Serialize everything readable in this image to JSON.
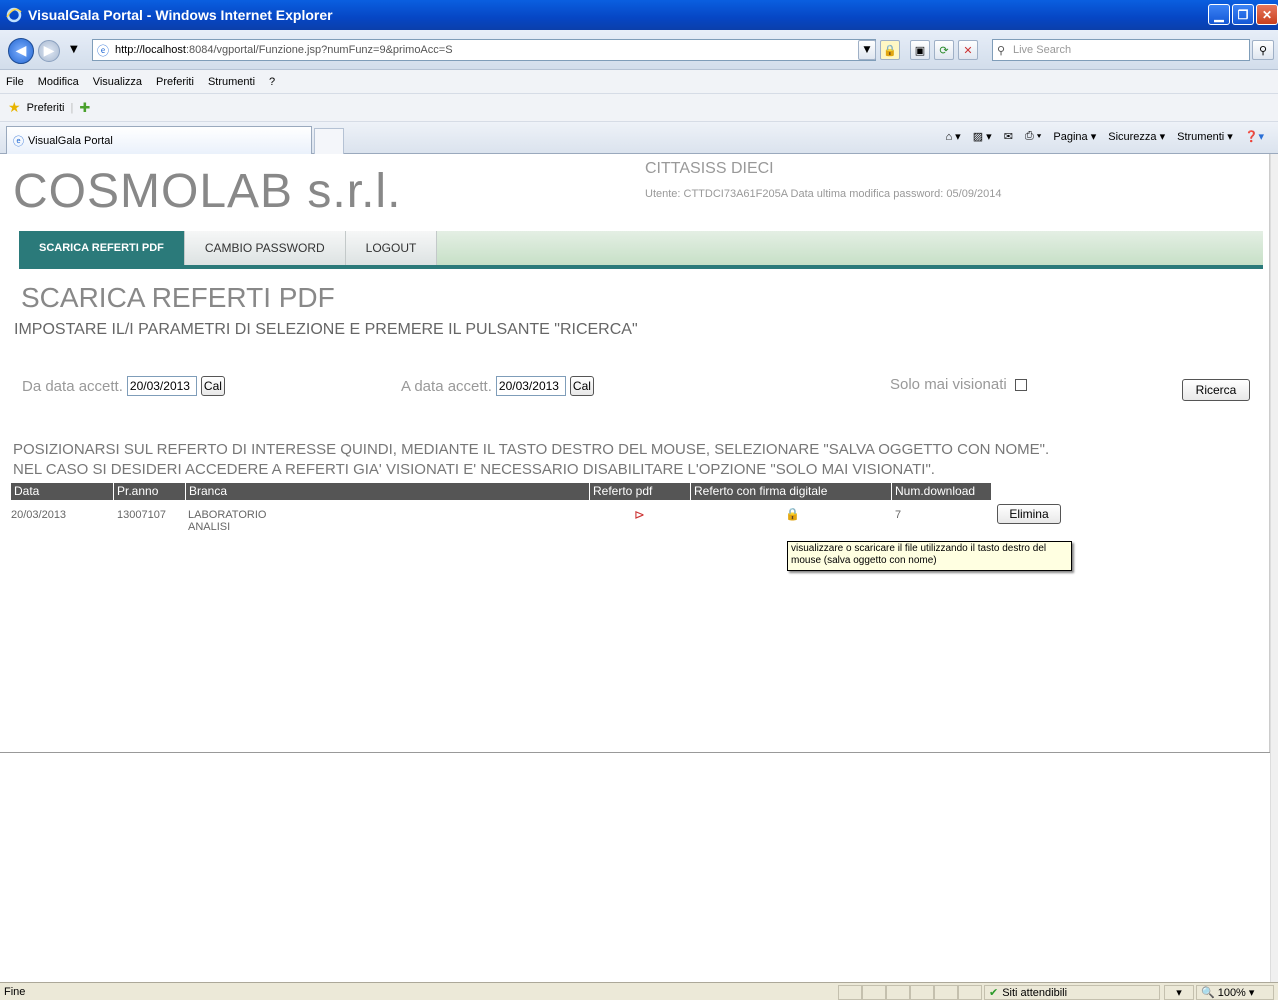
{
  "window": {
    "title": "VisualGala Portal - Windows Internet Explorer"
  },
  "address": {
    "url_host": "http://localhost",
    "url_rest": ":8084/vgportal/Funzione.jsp?numFunz=9&primoAcc=S",
    "search_placeholder": "Live Search"
  },
  "menubar": {
    "items": [
      "File",
      "Modifica",
      "Visualizza",
      "Preferiti",
      "Strumenti",
      "?"
    ]
  },
  "favorites": {
    "label": "Preferiti"
  },
  "tab": {
    "title": "VisualGala Portal"
  },
  "command_bar": {
    "items": [
      "Pagina ▾",
      "Sicurezza ▾",
      "Strumenti ▾"
    ]
  },
  "header": {
    "company": "COSMOLAB s.r.l.",
    "user_name": "CITTASISS DIECI",
    "user_info": "Utente: CTTDCI73A61F205A   Data ultima modifica password: 05/09/2014"
  },
  "nav": {
    "items": [
      {
        "label": "SCARICA REFERTI PDF"
      },
      {
        "label": "CAMBIO PASSWORD"
      },
      {
        "label": "LOGOUT"
      }
    ]
  },
  "page": {
    "title": "SCARICA REFERTI PDF",
    "subtitle": "IMPOSTARE IL/I PARAMETRI DI SELEZIONE E PREMERE IL PULSANTE \"RICERCA\""
  },
  "filters": {
    "from_label": "Da data accett.",
    "from_value": "20/03/2013",
    "to_label": "A data accett.",
    "to_value": "20/03/2013",
    "cal_label": "Cal",
    "only_unseen_label": "Solo mai visionati",
    "search_button": "Ricerca"
  },
  "instructions": {
    "line1": "POSIZIONARSI SUL REFERTO DI INTERESSE QUINDI, MEDIANTE IL TASTO DESTRO DEL MOUSE, SELEZIONARE \"SALVA OGGETTO CON NOME\".",
    "line2": "NEL CASO SI DESIDERI ACCEDERE A REFERTI GIA' VISIONATI E' NECESSARIO DISABILITARE L'OPZIONE \"SOLO MAI VISIONATI\"."
  },
  "table": {
    "headers": [
      "Data",
      "Pr.anno",
      "Branca",
      "Referto pdf",
      "Referto con firma digitale",
      "Num.download"
    ],
    "rows": [
      {
        "data": "20/03/2013",
        "pr_anno": "13007107",
        "branca": "LABORATORIO ANALISI",
        "pdf_icon": "pdf-icon",
        "signed_icon": "lock-icon",
        "downloads": "7",
        "action": "Elimina"
      }
    ]
  },
  "tooltip": {
    "text": "visualizzare o scaricare il file utilizzando il tasto destro del mouse (salva oggetto con nome)"
  },
  "status": {
    "left": "Fine",
    "zone": "Siti attendibili",
    "zoom": "100%"
  },
  "colors": {
    "nav_active": "#2b7a7a",
    "title_bar": "#0646c4"
  }
}
